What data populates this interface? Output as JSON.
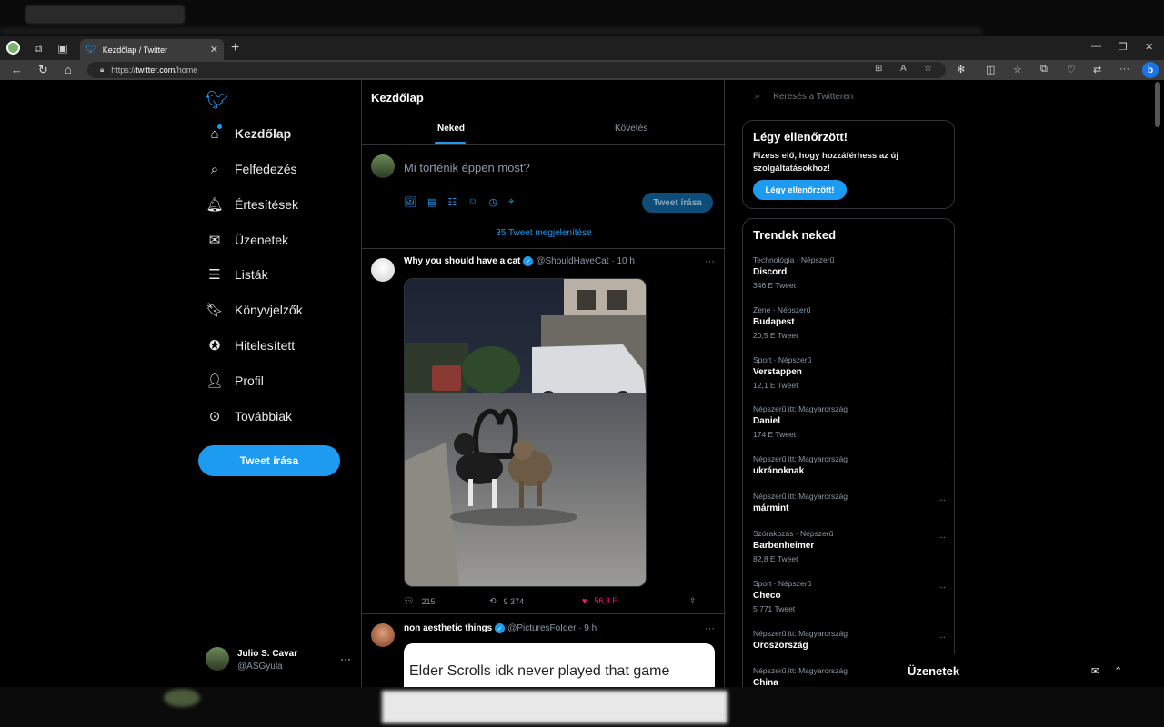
{
  "browser": {
    "tab_title": "Kezdőlap / Twitter",
    "url_prefix": "https://",
    "url_host": "twitter.com",
    "url_path": "/home",
    "new_tab_symbol": "+",
    "close_symbol": "✕"
  },
  "nav": {
    "items": [
      {
        "label": "Kezdőlap",
        "icon": "home-icon"
      },
      {
        "label": "Felfedezés",
        "icon": "search-icon"
      },
      {
        "label": "Értesítések",
        "icon": "bell-icon"
      },
      {
        "label": "Üzenetek",
        "icon": "mail-icon"
      },
      {
        "label": "Listák",
        "icon": "list-icon"
      },
      {
        "label": "Könyvjelzők",
        "icon": "bookmark-icon"
      },
      {
        "label": "Hitelesített",
        "icon": "verified-icon"
      },
      {
        "label": "Profil",
        "icon": "person-icon"
      },
      {
        "label": "Továbbiak",
        "icon": "more-circle-icon"
      }
    ],
    "tweet_button": "Tweet írása",
    "user": {
      "name": "Julio S. Cavar",
      "handle": "@ASGyula",
      "more": "···"
    }
  },
  "main": {
    "title": "Kezdőlap",
    "tabs": [
      "Neked",
      "Követés"
    ],
    "compose_placeholder": "Mi történik éppen most?",
    "compose_button": "Tweet írása",
    "show_tweets": "35 Tweet megjelenítése",
    "tweets": [
      {
        "name": "Why you should have a cat",
        "handle": "@ShouldHaveCat",
        "time": "· 10 h",
        "replies": "215",
        "retweets": "9 374",
        "likes": "56,3 E"
      },
      {
        "name": "non aesthetic things",
        "handle": "@PicturesFoIder",
        "time": "· 9 h",
        "card_text": "Elder Scrolls idk never played that game"
      }
    ]
  },
  "right": {
    "search_placeholder": "Keresés a Twitteren",
    "verify": {
      "title": "Légy ellenőrzött!",
      "text": "Fizess elő, hogy hozzáférhess az új szolgáltatásokhoz!",
      "button": "Légy ellenőrzött!"
    },
    "trends_title": "Trendek neked",
    "trends": [
      {
        "category": "Technológia · Népszerű",
        "topic": "Discord",
        "count": "346 E Tweet"
      },
      {
        "category": "Zene · Népszerű",
        "topic": "Budapest",
        "count": "20,5 E Tweet"
      },
      {
        "category": "Sport · Népszerű",
        "topic": "Verstappen",
        "count": "12,1 E Tweet"
      },
      {
        "category": "Népszerű itt: Magyarország",
        "topic": "Daniel",
        "count": "174 E Tweet"
      },
      {
        "category": "Népszerű itt: Magyarország",
        "topic": "ukránoknak",
        "count": ""
      },
      {
        "category": "Népszerű itt: Magyarország",
        "topic": "mármint",
        "count": ""
      },
      {
        "category": "Szórakozás · Népszerű",
        "topic": "Barbenheimer",
        "count": "82,8 E Tweet"
      },
      {
        "category": "Sport · Népszerű",
        "topic": "Checo",
        "count": "5 771 Tweet"
      },
      {
        "category": "Népszerű itt: Magyarország",
        "topic": "Oroszország",
        "count": ""
      },
      {
        "category": "Népszerű itt: Magyarország",
        "topic": "China",
        "count": ""
      }
    ],
    "messages_label": "Üzenetek"
  },
  "colors": {
    "accent": "#1d9bf0",
    "like": "#f91880",
    "background": "#000000"
  }
}
